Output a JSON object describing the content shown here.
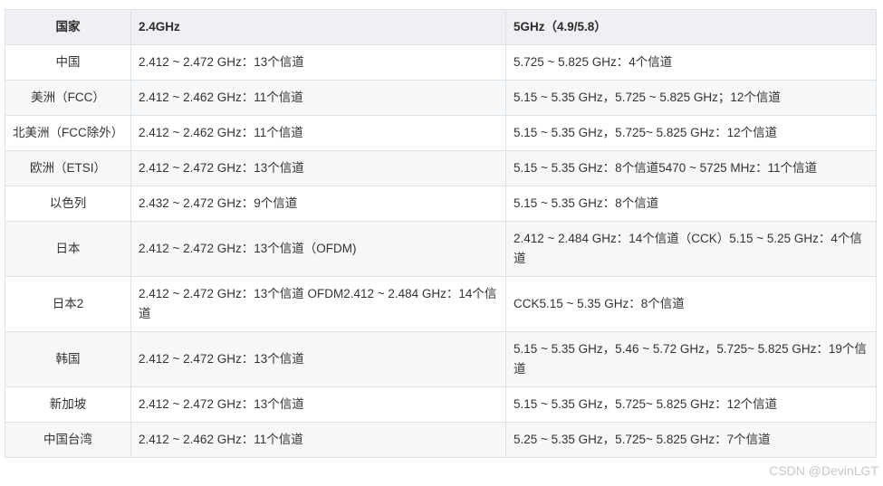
{
  "table": {
    "headers": [
      "国家",
      "2.4GHz",
      "5GHz（4.9/5.8）"
    ],
    "rows": [
      [
        "中国",
        "2.412 ~ 2.472 GHz：13个信道",
        "5.725 ~ 5.825 GHz：4个信道"
      ],
      [
        "美洲（FCC）",
        "2.412 ~ 2.462 GHz：11个信道",
        "5.15 ~ 5.35 GHz，5.725 ~ 5.825 GHz；12个信道"
      ],
      [
        "北美洲（FCC除外）",
        "2.412 ~ 2.462 GHz：11个信道",
        "5.15 ~ 5.35 GHz，5.725~ 5.825 GHz：12个信道"
      ],
      [
        "欧洲（ETSI）",
        "2.412 ~ 2.472 GHz：13个信道",
        "5.15 ~ 5.35 GHz：8个信道5470 ~ 5725 MHz：11个信道"
      ],
      [
        "以色列",
        "2.432 ~ 2.472 GHz：9个信道",
        "5.15 ~ 5.35 GHz：8个信道"
      ],
      [
        "日本",
        "2.412 ~ 2.472 GHz：13个信道（OFDM)",
        "2.412 ~ 2.484 GHz：14个信道（CCK）5.15 ~ 5.25 GHz：4个信道"
      ],
      [
        "日本2",
        "2.412 ~ 2.472 GHz：13个信道 OFDM2.412 ~ 2.484 GHz：14个信道",
        "CCK5.15 ~ 5.35 GHz：8个信道"
      ],
      [
        "韩国",
        "2.412 ~ 2.472 GHz：13个信道",
        "5.15 ~ 5.35 GHz，5.46 ~ 5.72 GHz，5.725~ 5.825 GHz：19个信道"
      ],
      [
        "新加坡",
        "2.412 ~ 2.472 GHz：13个信道",
        "5.15 ~ 5.35 GHz，5.725~ 5.825 GHz：12个信道"
      ],
      [
        "中国台湾",
        "2.412 ~ 2.462 GHz：11个信道",
        "5.25 ~ 5.35 GHz，5.725~ 5.825 GHz：7个信道"
      ]
    ]
  },
  "watermark": "CSDN @DevinLGT",
  "colors": {
    "header_bg": "#eef0f4",
    "stripe_bg": "#f6f7f9",
    "border": "#dfe2e5",
    "text": "#333333"
  }
}
